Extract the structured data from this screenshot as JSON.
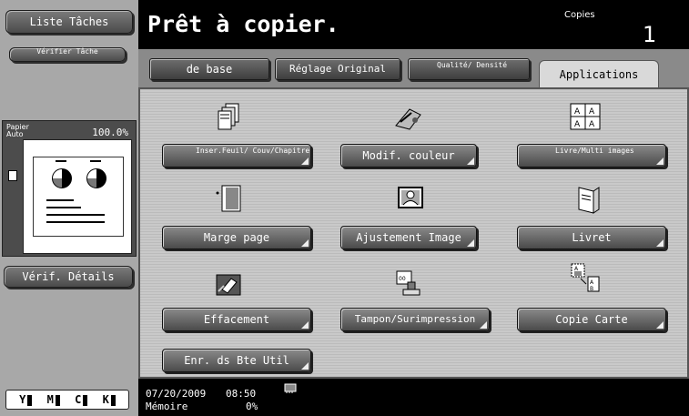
{
  "left": {
    "job_list": "Liste Tâches",
    "check_job": "Vérifier Tâche",
    "paper_label": "Papier Auto",
    "zoom": "100.0%",
    "check_details": "Vérif. Détails",
    "toner": [
      "Y",
      "M",
      "C",
      "K"
    ]
  },
  "header": {
    "status": "Prêt à copier.",
    "copies_label": "Copies",
    "copies_value": "1"
  },
  "tabs": {
    "basic": "de base",
    "original": "Réglage Original",
    "quality": "Qualité/ Densité",
    "applications": "Applications"
  },
  "functions": {
    "insert_sheet": "Inser.Feuil/ Couv/Chapitre",
    "color_adjust": "Modif. couleur",
    "book_copy": "Livre/Multi images",
    "page_margin": "Marge page",
    "image_adjust": "Ajustement Image",
    "booklet": "Livret",
    "erase": "Effacement",
    "stamp": "Tampon/Surimpression",
    "card_copy": "Copie Carte",
    "save_box": "Enr. ds Bte Util"
  },
  "footer": {
    "date": "07/20/2009",
    "time": "08:50",
    "memory_label": "Mémoire",
    "memory_value": "0%"
  }
}
